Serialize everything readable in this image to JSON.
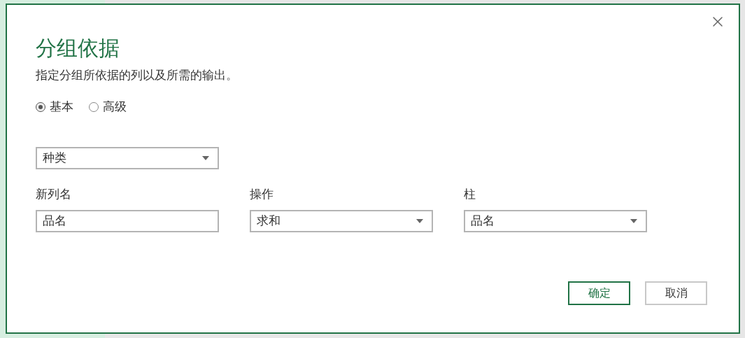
{
  "dialog": {
    "title": "分组依据",
    "description": "指定分组所依据的列以及所需的输出。",
    "modes": [
      {
        "label": "基本",
        "selected": true
      },
      {
        "label": "高级",
        "selected": false
      }
    ],
    "group_by": {
      "value": "种类"
    },
    "fields": [
      {
        "label": "新列名",
        "kind": "text",
        "value": "品名"
      },
      {
        "label": "操作",
        "kind": "dropdown",
        "value": "求和"
      },
      {
        "label": "柱",
        "kind": "dropdown",
        "value": "品名"
      }
    ],
    "buttons": [
      {
        "label": "确定",
        "kind": "primary"
      },
      {
        "label": "取消",
        "kind": "secondary"
      }
    ]
  }
}
